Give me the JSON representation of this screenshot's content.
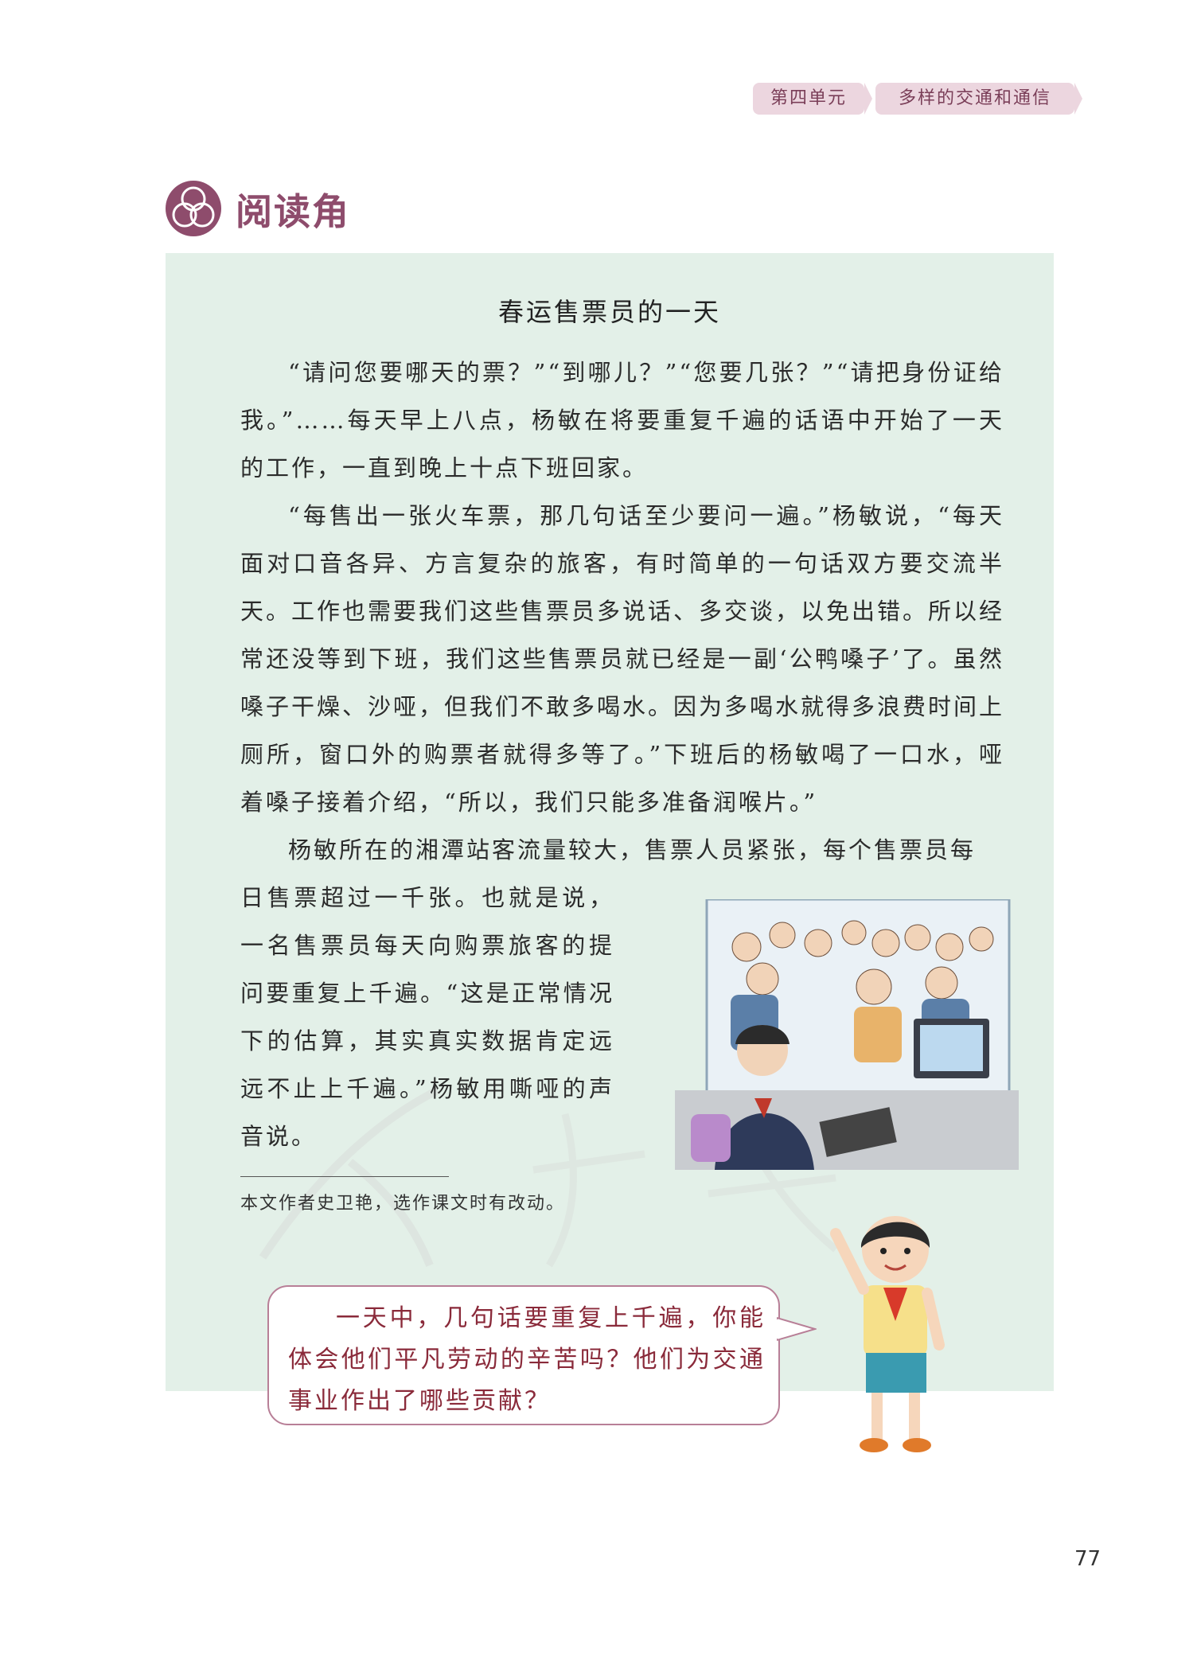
{
  "header": {
    "unit_label": "第四单元",
    "unit_title": "多样的交通和通信"
  },
  "section": {
    "title": "阅读角"
  },
  "article": {
    "title": "春运售票员的一天",
    "paragraphs": [
      "“请问您要哪天的票？”“到哪儿？”“您要几张？”“请把身份证给我。”……每天早上八点，杨敏在将要重复千遍的话语中开始了一天的工作，一直到晚上十点下班回家。",
      "“每售出一张火车票，那几句话至少要问一遍。”杨敏说，“每天面对口音各异、方言复杂的旅客，有时简单的一句话双方要交流半天。工作也需要我们这些售票员多说话、多交谈，以免出错。所以经常还没等到下班，我们这些售票员就已经是一副‘公鸭嗓子’了。虽然嗓子干燥、沙哑，但我们不敢多喝水。因为多喝水就得多浪费时间上厕所，窗口外的购票者就得多等了。”下班后的杨敏喝了一口水，哑着嗓子接着介绍，“所以，我们只能多准备润喉片。”",
      "杨敏所在的湘潭站客流量较大，售票人员紧张，每个售票员每",
      "日售票超过一千张。也就是说，一名售票员每天向购票旅客的提问要重复上千遍。“这是正常情况下的估算，其实真实数据肯定远远不止上千遍。”杨敏用嘶哑的声音说。"
    ],
    "note": "本文作者史卫艳，选作课文时有改动。"
  },
  "bubble": {
    "text": "一天中，几句话要重复上千遍，你能体会他们平凡劳动的辛苦吗？他们为交通事业作出了哪些贡献？"
  },
  "page_number": "77",
  "colors": {
    "panel": "#e3f0e8",
    "accent": "#8e4c6c",
    "tab": "#ecd6df",
    "bubble_text": "#8a2a3a"
  },
  "icons": [
    "reading-corner-icon",
    "ticket-seller-illustration",
    "boy-illustration",
    "watermark"
  ]
}
